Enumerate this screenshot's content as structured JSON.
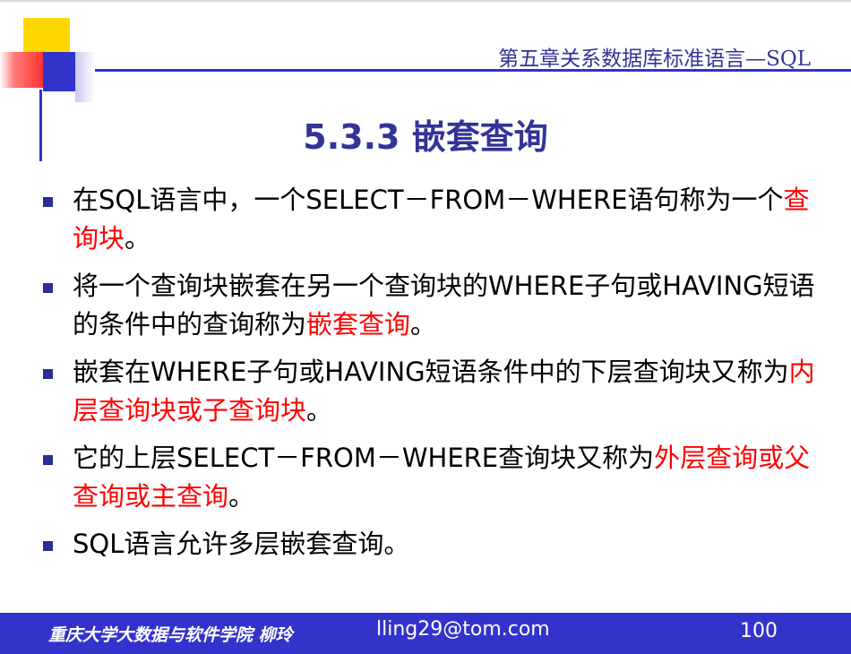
{
  "slide": {
    "chapter": "第五章关系数据库标准语言—SQL",
    "title": "5.3.3 嵌套查询",
    "bullets": [
      [
        {
          "text": "在SQL语言中，一个SELECT－FROM－WHERE语句称为一个",
          "highlight": false
        },
        {
          "text": "查询块",
          "highlight": true
        },
        {
          "text": "。",
          "highlight": false
        }
      ],
      [
        {
          "text": "将一个查询块嵌套在另一个查询块的WHERE子句或HAVING短语的条件中的查询称为",
          "highlight": false
        },
        {
          "text": "嵌套查询",
          "highlight": true
        },
        {
          "text": "。",
          "highlight": false
        }
      ],
      [
        {
          "text": "嵌套在WHERE子句或HAVING短语条件中的下层查询块又称为",
          "highlight": false
        },
        {
          "text": "内层查询块或子查询块",
          "highlight": true
        },
        {
          "text": "。",
          "highlight": false
        }
      ],
      [
        {
          "text": "它的上层SELECT－FROM－WHERE查询块又称为",
          "highlight": false
        },
        {
          "text": "外层查询或父查询或主查询",
          "highlight": true
        },
        {
          "text": "。",
          "highlight": false
        }
      ],
      [
        {
          "text": "SQL语言允许多层嵌套查询。",
          "highlight": false
        }
      ]
    ]
  },
  "footer": {
    "school": "重庆大学大数据与软件学院  柳玲",
    "email": "lling29@tom.com",
    "page": "100"
  },
  "colors": {
    "accent": "#3333cc",
    "title": "#333399",
    "highlight": "#ff0000",
    "yellow": "#ffd700"
  }
}
